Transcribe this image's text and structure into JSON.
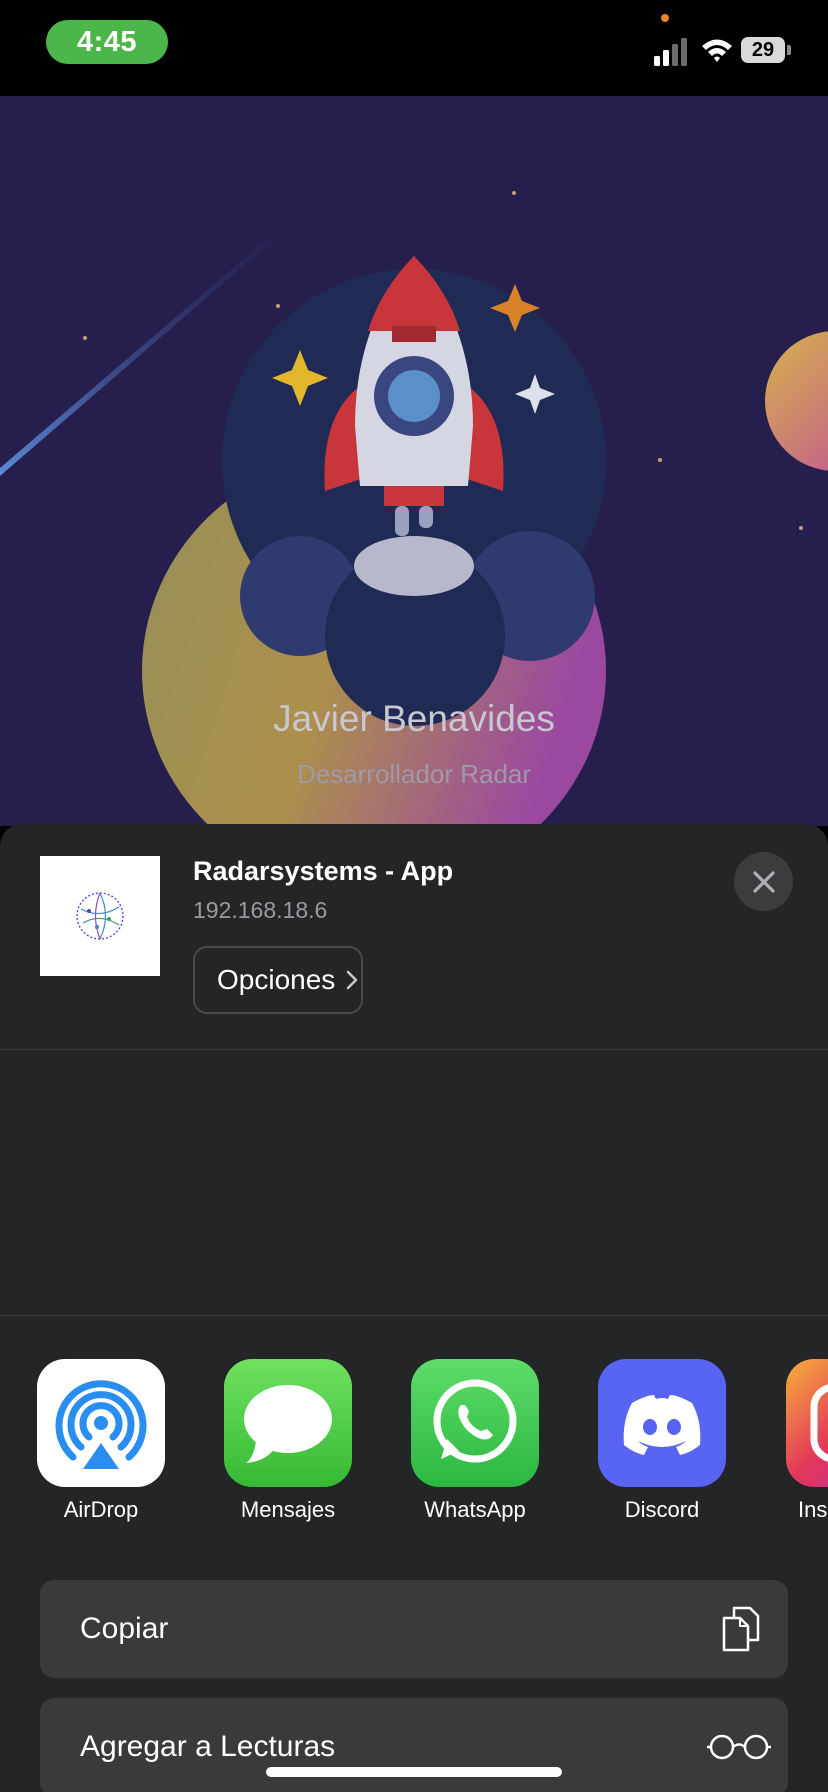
{
  "status_bar": {
    "time": "4:45",
    "battery": "29"
  },
  "web_profile": {
    "name": "Javier Benavides",
    "role": "Desarrollador Radar"
  },
  "share_sheet": {
    "title": "Radarsystems - App",
    "subtitle": "192.168.18.6",
    "options_label": "Opciones",
    "apps": [
      {
        "label": "AirDrop",
        "icon": "airdrop-icon"
      },
      {
        "label": "Mensajes",
        "icon": "messages-icon"
      },
      {
        "label": "WhatsApp",
        "icon": "whatsapp-icon"
      },
      {
        "label": "Discord",
        "icon": "discord-icon"
      },
      {
        "label": "Ins",
        "icon": "instagram-icon"
      }
    ],
    "actions": [
      {
        "label": "Copiar",
        "icon": "copy-icon"
      },
      {
        "label": "Agregar a Lecturas",
        "icon": "reading-glasses-icon"
      }
    ]
  },
  "colors": {
    "sheet_bg": "#242526",
    "action_bg": "#3a3a3c",
    "time_pill": "#4cb64a"
  }
}
